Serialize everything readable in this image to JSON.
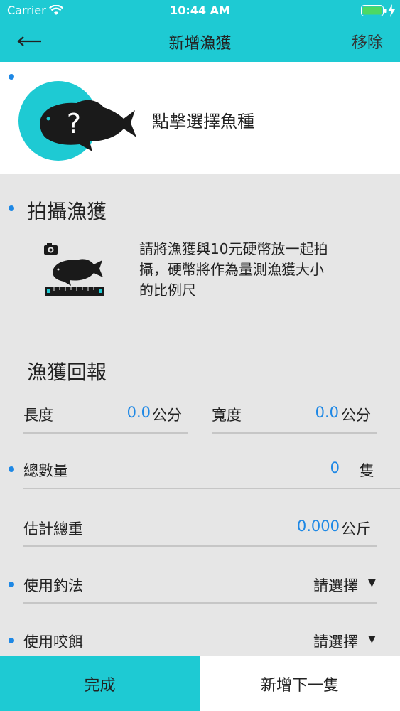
{
  "status": {
    "carrier": "Carrier",
    "time": "10:44 AM"
  },
  "nav": {
    "title": "新增漁獲",
    "remove": "移除"
  },
  "species": {
    "label": "點擊選擇魚種"
  },
  "photo": {
    "title": "拍攝漁獲",
    "desc_lines": [
      "請將漁獲與10元硬幣放一起拍",
      "攝，硬幣將作為量測漁獲大小",
      "的比例尺"
    ]
  },
  "report": {
    "title": "漁獲回報",
    "length": {
      "label": "長度",
      "value": "0.0",
      "unit": "公分"
    },
    "width": {
      "label": "寬度",
      "value": "0.0",
      "unit": "公分"
    },
    "count": {
      "label": "總數量",
      "value": "0",
      "unit": "隻"
    },
    "weight": {
      "label": "估計總重",
      "value": "0.000",
      "unit": "公斤"
    },
    "method": {
      "label": "使用釣法",
      "value": "請選擇"
    },
    "bait": {
      "label": "使用咬餌",
      "value": "請選擇"
    }
  },
  "bottom": {
    "done": "完成",
    "next": "新增下一隻"
  },
  "colors": {
    "accent": "#1ecad3",
    "value_blue": "#1e88e5",
    "background": "#e6e6e6"
  }
}
